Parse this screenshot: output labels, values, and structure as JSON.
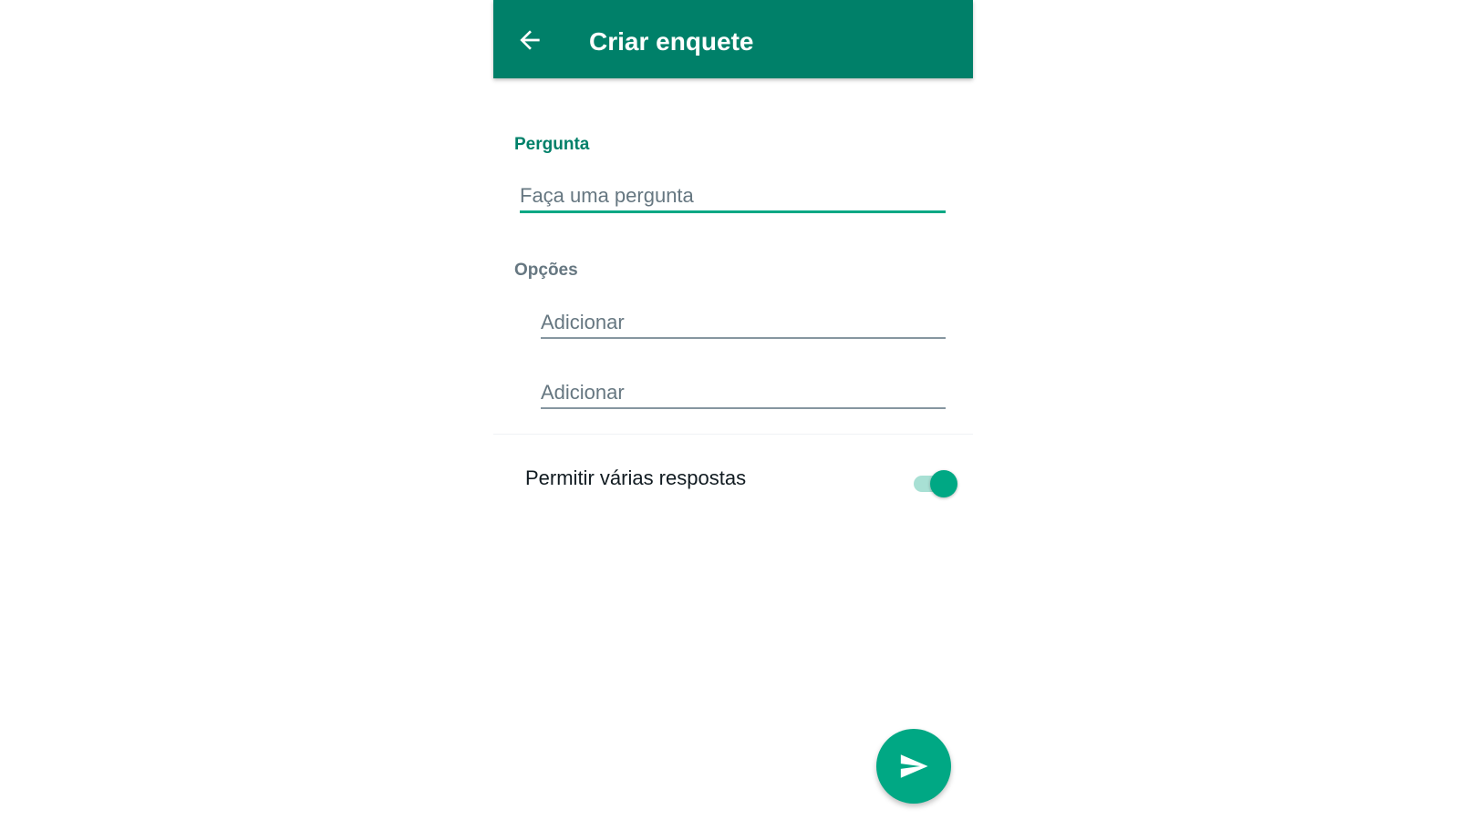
{
  "header": {
    "title": "Criar enquete",
    "back_icon": "arrow-left-icon",
    "background_color": "#008069"
  },
  "question": {
    "label": "Pergunta",
    "placeholder": "Faça uma pergunta",
    "value": ""
  },
  "options": {
    "label": "Opções",
    "fields": [
      {
        "placeholder": "Adicionar",
        "value": ""
      },
      {
        "placeholder": "Adicionar",
        "value": ""
      }
    ]
  },
  "settings": {
    "multiple_answers_label": "Permitir várias respostas",
    "multiple_answers_enabled": true
  },
  "fab": {
    "icon": "send-icon",
    "color": "#00a884"
  },
  "colors": {
    "accent": "#00a884",
    "header": "#008069",
    "muted": "#667781"
  }
}
